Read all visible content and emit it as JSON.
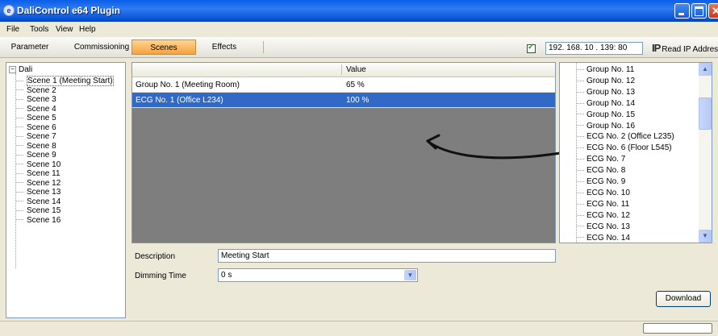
{
  "window": {
    "title": "DaliControl e64 Plugin"
  },
  "menu": [
    "File",
    "Tools",
    "View",
    "Help"
  ],
  "tabs": [
    "Parameter",
    "Commissioning",
    "Scenes",
    "Effects"
  ],
  "active_tab": "Scenes",
  "ip": {
    "checked": true,
    "address": "192. 168. 10 . 139: 80",
    "read_label": "Read IP Address",
    "read_icon": "IP"
  },
  "tree": {
    "root": "Dali",
    "items": [
      "Scene 1 (Meeting Start)",
      "Scene 2",
      "Scene 3",
      "Scene 4",
      "Scene 5",
      "Scene 6",
      "Scene 7",
      "Scene 8",
      "Scene 9",
      "Scene 10",
      "Scene 11",
      "Scene 12",
      "Scene 13",
      "Scene 14",
      "Scene 15",
      "Scene 16"
    ],
    "selected_index": 0
  },
  "grid": {
    "header_value": "Value",
    "rows": [
      {
        "name": "Group No. 1 (Meeting Room)",
        "value": "65 %"
      },
      {
        "name": "ECG No. 1 (Office L234)",
        "value": "100 %",
        "selected": true
      }
    ]
  },
  "right_list": {
    "items": [
      "Group No. 11",
      "Group No. 12",
      "Group No. 13",
      "Group No. 14",
      "Group No. 15",
      "Group No. 16",
      "ECG No. 2 (Office L235)",
      "ECG No. 6 (Floor L545)",
      "ECG No. 7",
      "ECG No. 8",
      "ECG No. 9",
      "ECG No. 10",
      "ECG No. 11",
      "ECG No. 12",
      "ECG No. 13",
      "ECG No. 14"
    ]
  },
  "form": {
    "description_label": "Description",
    "description_value": "Meeting Start",
    "dimming_label": "Dimming Time",
    "dimming_value": "0 s"
  },
  "buttons": {
    "download": "Download"
  },
  "colors": {
    "title_bar": "#0a5ee8",
    "active_tab": "#f5a13c",
    "selected_row": "#3169c6",
    "grid_bg": "#7e7e7e"
  }
}
